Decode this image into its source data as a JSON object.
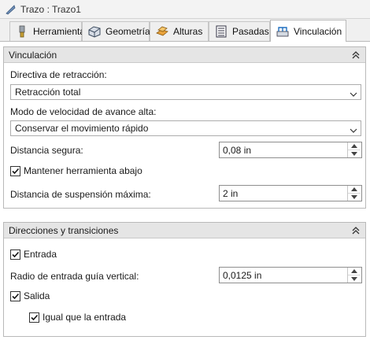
{
  "window": {
    "title": "Trazo : Trazo1"
  },
  "tabs": [
    {
      "label": "Herramienta",
      "icon": "tool-icon"
    },
    {
      "label": "Geometría",
      "icon": "geometry-icon"
    },
    {
      "label": "Alturas",
      "icon": "heights-icon"
    },
    {
      "label": "Pasadas",
      "icon": "passes-icon"
    },
    {
      "label": "Vinculación",
      "icon": "linking-icon",
      "active": true
    }
  ],
  "vinculacion": {
    "header": "Vinculación",
    "retract_label": "Directiva de retracción:",
    "retract_value": "Retracción total",
    "feed_label": "Modo de velocidad de avance alta:",
    "feed_value": "Conservar el movimiento rápido",
    "safe_label": "Distancia segura:",
    "safe_value": "0,08 in",
    "keep_down_label": "Mantener herramienta abajo",
    "keep_down_checked": true,
    "stay_down_label": "Distancia de suspensión máxima:",
    "stay_down_value": "2 in"
  },
  "transiciones": {
    "header": "Direcciones y transiciones",
    "entry_label": "Entrada",
    "entry_checked": true,
    "radius_label": "Radio de entrada guía vertical:",
    "radius_value": "0,0125 in",
    "exit_label": "Salida",
    "exit_checked": true,
    "same_as_entry_label": "Igual que la entrada",
    "same_as_entry_checked": true
  }
}
